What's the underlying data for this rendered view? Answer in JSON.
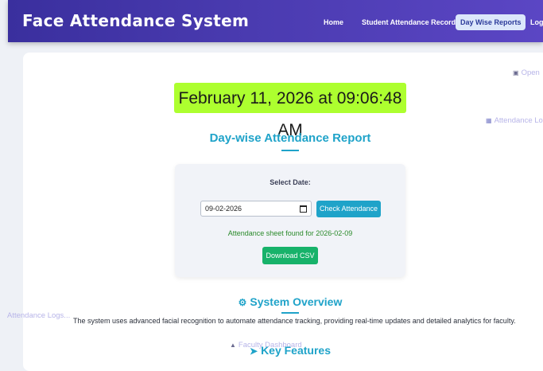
{
  "app": {
    "title": "Face Attendance System"
  },
  "nav": {
    "items": [
      {
        "label": "Home"
      },
      {
        "label": "Student Attendance Records"
      },
      {
        "label": "Day Wise Reports"
      },
      {
        "label": "Logout"
      }
    ],
    "active_index": 2
  },
  "floating_links": {
    "open": "Open",
    "attendance_logs_right": "Attendance Logs",
    "attendance_logs_left": "Attendance Logs...",
    "faculty_dashboard": "Faculty Dashboard"
  },
  "datetime": "February 11, 2026 at 09:06:48 AM",
  "report": {
    "title": "Day-wise Attendance Report",
    "select_label": "Select Date:",
    "date_value": "09-02-2026",
    "check_button": "Check Attendance",
    "found_message": "Attendance sheet found for 2026-02-09",
    "download_button": "Download CSV"
  },
  "overview": {
    "title": "System Overview",
    "text": "The system uses advanced facial recognition to automate attendance tracking, providing real-time updates and detailed analytics for faculty."
  },
  "features": {
    "title": "Key Features"
  },
  "colors": {
    "navbar": "#4a3bb0",
    "accent": "#1fa3c9",
    "datetime_bg": "#adff2f",
    "success": "#17b26a"
  }
}
